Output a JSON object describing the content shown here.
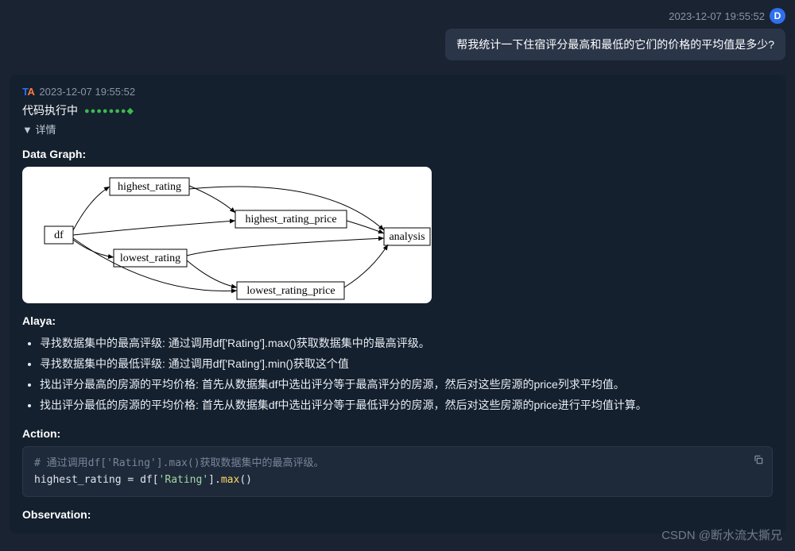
{
  "user": {
    "timestamp": "2023-12-07 19:55:52",
    "avatar_letter": "D",
    "message": "帮我统计一下住宿评分最高和最低的它们的价格的平均值是多少?"
  },
  "assistant": {
    "timestamp": "2023-12-07 19:55:52",
    "exec_label": "代码执行中",
    "dots": "●●●●●●●◆",
    "details_toggle": "▼ 详情",
    "data_graph_label": "Data Graph:",
    "graph": {
      "nodes": [
        "df",
        "highest_rating",
        "lowest_rating",
        "highest_rating_price",
        "lowest_rating_price",
        "analysis"
      ]
    },
    "alaya_label": "Alaya:",
    "alaya_items": [
      "寻找数据集中的最高评级: 通过调用df['Rating'].max()获取数据集中的最高评级。",
      "寻找数据集中的最低评级: 通过调用df['Rating'].min()获取这个值",
      "找出评分最高的房源的平均价格: 首先从数据集df中选出评分等于最高评分的房源，然后对这些房源的price列求平均值。",
      "找出评分最低的房源的平均价格: 首先从数据集df中选出评分等于最低评分的房源，然后对这些房源的price进行平均值计算。"
    ],
    "action_label": "Action:",
    "code": {
      "comment": "# 通过调用df['Rating'].max()获取数据集中的最高评级。",
      "line2_var": "highest_rating",
      "line2_eq": " = ",
      "line2_df": "df[",
      "line2_str": "'Rating'",
      "line2_close": "].",
      "line2_func": "max",
      "line2_paren": "()"
    },
    "observation_label": "Observation:"
  },
  "watermark": "CSDN @断水流大撕兄"
}
